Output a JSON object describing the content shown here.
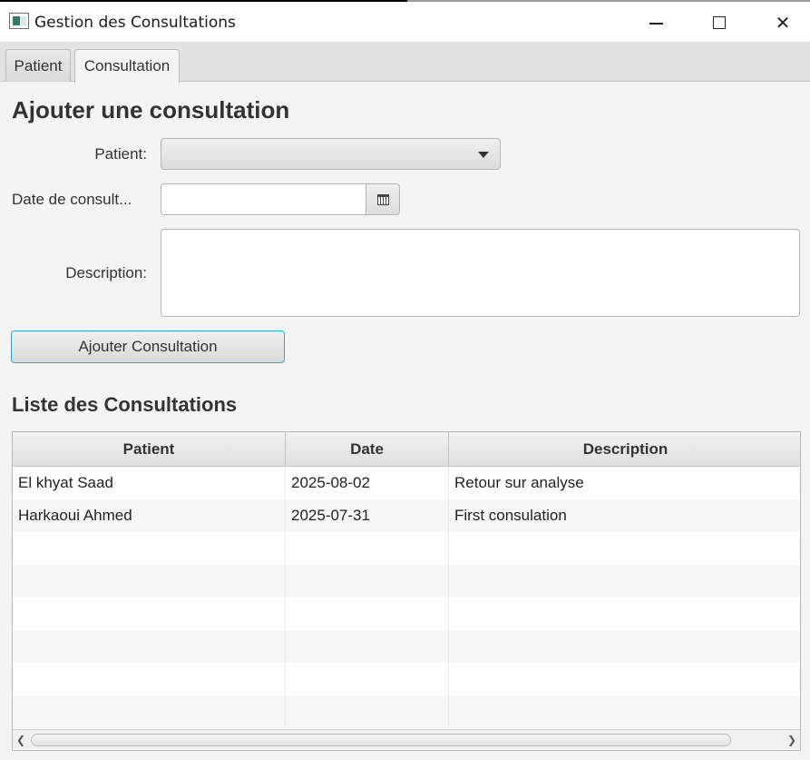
{
  "window": {
    "title": "Gestion des Consultations",
    "minimize_icon": "minimize-icon",
    "maximize_icon": "maximize-icon",
    "close_icon": "close-icon"
  },
  "tabs": [
    {
      "label": "Patient",
      "selected": false
    },
    {
      "label": "Consultation",
      "selected": true
    }
  ],
  "form": {
    "title": "Ajouter une consultation",
    "patient_label": "Patient:",
    "patient_value": "",
    "date_label": "Date de consult...",
    "date_value": "",
    "description_label": "Description:",
    "description_value": "",
    "submit_label": "Ajouter Consultation"
  },
  "list": {
    "title": "Liste des Consultations",
    "columns": [
      "Patient",
      "Date",
      "Description"
    ],
    "rows": [
      [
        "El khyat Saad",
        "2025-08-02",
        "Retour sur analyse"
      ],
      [
        "Harkaoui Ahmed",
        "2025-07-31",
        "First consulation"
      ]
    ]
  },
  "colors": {
    "accent_focus": "#2ea5dc",
    "background": "#f4f4f4"
  }
}
